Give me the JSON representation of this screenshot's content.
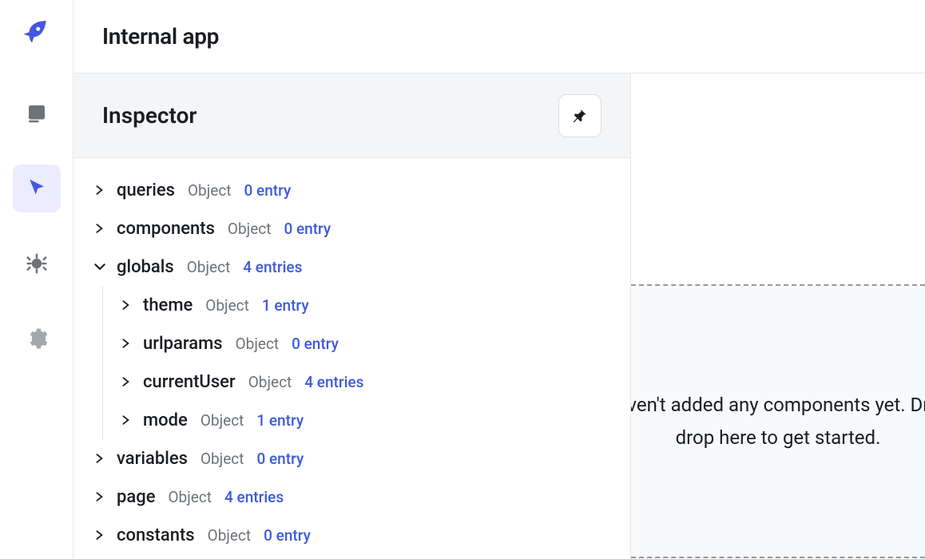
{
  "header": {
    "app_title": "Internal app"
  },
  "inspector": {
    "title": "Inspector",
    "type_label": "Object",
    "nodes": {
      "queries": {
        "name": "queries",
        "count": "0 entry"
      },
      "components": {
        "name": "components",
        "count": "0 entry"
      },
      "globals": {
        "name": "globals",
        "count": "4 entries",
        "children": {
          "theme": {
            "name": "theme",
            "count": "1 entry"
          },
          "urlparams": {
            "name": "urlparams",
            "count": "0 entry"
          },
          "currentUser": {
            "name": "currentUser",
            "count": "4 entries"
          },
          "mode": {
            "name": "mode",
            "count": "1 entry"
          }
        }
      },
      "variables": {
        "name": "variables",
        "count": "0 entry"
      },
      "page": {
        "name": "page",
        "count": "4 entries"
      },
      "constants": {
        "name": "constants",
        "count": "0 entry"
      }
    }
  },
  "canvas": {
    "line1": "You haven't added any components yet. Drag and",
    "line2": "drop here to get started."
  }
}
